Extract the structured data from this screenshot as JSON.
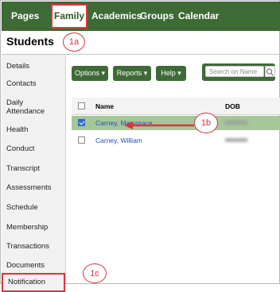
{
  "topnav": {
    "tabs": [
      {
        "label": "Pages",
        "active": false
      },
      {
        "label": "Family",
        "active": true
      },
      {
        "label": "Academics",
        "active": false
      },
      {
        "label": "Groups",
        "active": false
      },
      {
        "label": "Calendar",
        "active": false
      }
    ]
  },
  "header": {
    "title": "Students"
  },
  "callouts": {
    "a": "1a",
    "b": "1b",
    "c": "1c"
  },
  "sidebar": {
    "items": [
      "Details",
      "Contacts",
      "Daily Attendance",
      "Health",
      "Conduct",
      "Transcript",
      "Assessments",
      "Schedule",
      "Membership",
      "Transactions",
      "Documents",
      "Notification"
    ],
    "highlighted": "Notification"
  },
  "toolbar": {
    "options_label": "Options ▾",
    "reports_label": "Reports ▾",
    "help_label": "Help ▾",
    "search_placeholder": "Search on Name"
  },
  "table": {
    "columns": [
      "Name",
      "DOB"
    ],
    "rows": [
      {
        "name": "Carney, Marygrace",
        "checked": true
      },
      {
        "name": "Carney, William",
        "checked": false
      }
    ]
  },
  "colors": {
    "nav_green": "#3e6a36",
    "selected_row": "#a5c799",
    "callout_red": "#d9363e",
    "link_blue": "#1f4fc4"
  }
}
